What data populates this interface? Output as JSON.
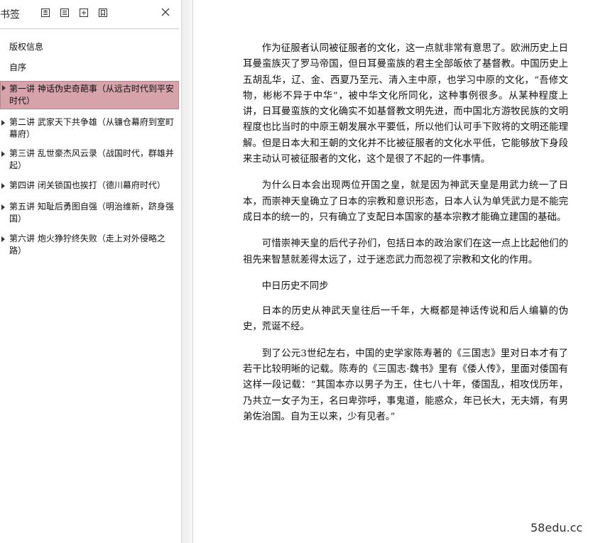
{
  "sidebar": {
    "title": "书签",
    "toolbar": {
      "icons": [
        "expand-all-icon",
        "collapse-all-icon",
        "add-bookmark-icon",
        "bookmark-icon"
      ],
      "close_icon": "close-icon"
    },
    "items": [
      {
        "label": "版权信息",
        "has_children": false,
        "selected": false
      },
      {
        "label": "自序",
        "has_children": false,
        "selected": false
      },
      {
        "label": "第一讲 神话伪史奇葩事（从远古时代到平安时代）",
        "has_children": true,
        "selected": true
      },
      {
        "label": "第二讲 武家天下共争雄（从镰仓幕府到室町幕府）",
        "has_children": true,
        "selected": false
      },
      {
        "label": "第三讲 乱世豪杰风云录（战国时代，群雄并起）",
        "has_children": true,
        "selected": false
      },
      {
        "label": "第四讲 闭关锁国也挨打（德川幕府时代）",
        "has_children": true,
        "selected": false
      },
      {
        "label": "第五讲 知耻后勇图自强（明治维新，跻身强国）",
        "has_children": true,
        "selected": false
      },
      {
        "label": "第六讲 炮火狰狞终失败（走上对外侵略之路）",
        "has_children": true,
        "selected": false
      }
    ],
    "selected_color": "#d6a3ab"
  },
  "document": {
    "paragraphs": [
      "作为征服者认同被征服者的文化，这一点就非常有意思了。欧洲历史上日耳曼蛮族灭了罗马帝国，但日耳曼蛮族的君主全部皈依了基督教。中国历史上五胡乱华，辽、金、西夏乃至元、清入主中原，也学习中原的文化，“吾修文物，彬彬不异于中华”，被中华文化所同化，这种事例很多。从某种程度上讲，日耳曼蛮族的文化确实不如基督教文明先进，而中国北方游牧民族的文明程度也比当时的中原王朝发展水平要低，所以他们认可手下败将的文明还能理解。但是日本大和王朝的文化并不比被征服者的文化水平低，它能够放下身段来主动认可被征服者的文化，这个是很了不起的一件事情。",
      "为什么日本会出现两位开国之皇，就是因为神武天皇是用武力统一了日本，而崇神天皇确立了日本的宗教和意识形态，日本人认为单凭武力是不能完成日本的统一的，只有确立了支配日本国家的基本宗教才能确立建国的基础。",
      "可惜崇神天皇的后代子孙们，包括日本的政治家们在这一点上比起他们的祖先来智慧就差得太远了，过于迷恋武力而忽视了宗教和文化的作用。",
      "中日历史不同步",
      "日本的历史从神武天皇往后一千年，大概都是神话传说和后人编纂的伪史，荒诞不经。",
      "到了公元3世纪左右，中国的史学家陈寿著的《三国志》里对日本才有了若干比较明晰的记载。陈寿的《三国志·魏书》里有《倭人传》，里面对倭国有这样一段记载：“其国本亦以男子为王，住七八十年，倭国乱，相攻伐历年，乃共立一女子为王，名曰卑弥呼，事鬼道，能惑众，年已长大，无夫婿，有男弟佐治国。自为王以来，少有见者。”"
    ]
  },
  "watermark": "58edu.cc"
}
